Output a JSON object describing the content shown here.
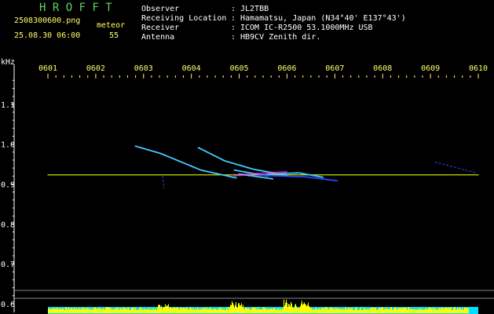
{
  "app": {
    "brand": "H R O F F T",
    "filename": "2508300600.png",
    "datetime": "25.08.30 06:00",
    "meteor_label": "meteor",
    "meteor_count": "55"
  },
  "station": {
    "labels": [
      "Observer",
      "Receiving Location",
      "Receiver",
      "Antenna"
    ],
    "separator": ":",
    "values": [
      "JL2TBB",
      "Hamamatsu, Japan (N34°40' E137°43')",
      "ICOM IC-R2500 53.1000MHz USB",
      "HB9CV Zenith dir."
    ]
  },
  "colors": {
    "background": "#000000",
    "brand": "#5fd35f",
    "tick_label": "#ffff66",
    "axis": "#ffffff",
    "baseline": "#c8e000",
    "trace_cyan": "#3fd0ff",
    "trace_blue": "#2a4bff",
    "trace_magenta": "#ff4fff",
    "spectrum_yellow": "#ffff00",
    "spectrum_cyan": "#00e0ff"
  },
  "chart_data": {
    "type": "line",
    "title": "",
    "xlabel": "",
    "ylabel": "kHz",
    "x_tick_labels": [
      "0601",
      "0602",
      "0603",
      "0604",
      "0605",
      "0606",
      "0607",
      "0608",
      "0609",
      "0610"
    ],
    "y_tick_labels": [
      "1.1",
      "1.0",
      "0.9",
      "0.8",
      "0.7",
      "0.6"
    ],
    "y_ticks": [
      1.1,
      1.0,
      0.9,
      0.8,
      0.7,
      0.6
    ],
    "xlim": [
      0.0,
      9.0
    ],
    "ylim": [
      0.59,
      1.2
    ],
    "grid": false,
    "series": [
      {
        "style": "carrier",
        "color": "#c8e000",
        "x": [
          0.0,
          9.0
        ],
        "y": [
          0.923,
          0.923
        ]
      },
      {
        "style": "meteor",
        "color": "#3fd0ff",
        "x": [
          1.83,
          2.35,
          3.2,
          3.95
        ],
        "y": [
          0.995,
          0.977,
          0.935,
          0.915
        ]
      },
      {
        "style": "meteor",
        "color": "#3fd0ff",
        "x": [
          3.15,
          3.7,
          4.3,
          5.0
        ],
        "y": [
          0.991,
          0.958,
          0.937,
          0.922
        ]
      },
      {
        "style": "meteor",
        "color": "#3fd0ff",
        "x": [
          3.9,
          4.6,
          4.6,
          5.25,
          5.75
        ],
        "y": [
          0.935,
          0.92,
          0.925,
          0.928,
          0.917
        ]
      },
      {
        "style": "meteor",
        "color": "#2a4bff",
        "x": [
          4.4,
          5.4,
          6.05
        ],
        "y": [
          0.922,
          0.918,
          0.908
        ]
      },
      {
        "style": "meteor",
        "color": "#3fd0ff",
        "x": [
          4.0,
          4.7
        ],
        "y": [
          0.925,
          0.913
        ]
      },
      {
        "style": "faint",
        "color": "#2a4bff",
        "x": [
          8.1,
          8.95
        ],
        "y": [
          0.955,
          0.928
        ]
      },
      {
        "style": "faint",
        "color": "#2a4bff",
        "x": [
          2.4,
          2.43
        ],
        "y": [
          0.92,
          0.89
        ]
      },
      {
        "style": "head",
        "color": "#ff4fff",
        "x": [
          3.9,
          5.0
        ],
        "y": [
          0.922,
          0.93
        ]
      }
    ]
  }
}
